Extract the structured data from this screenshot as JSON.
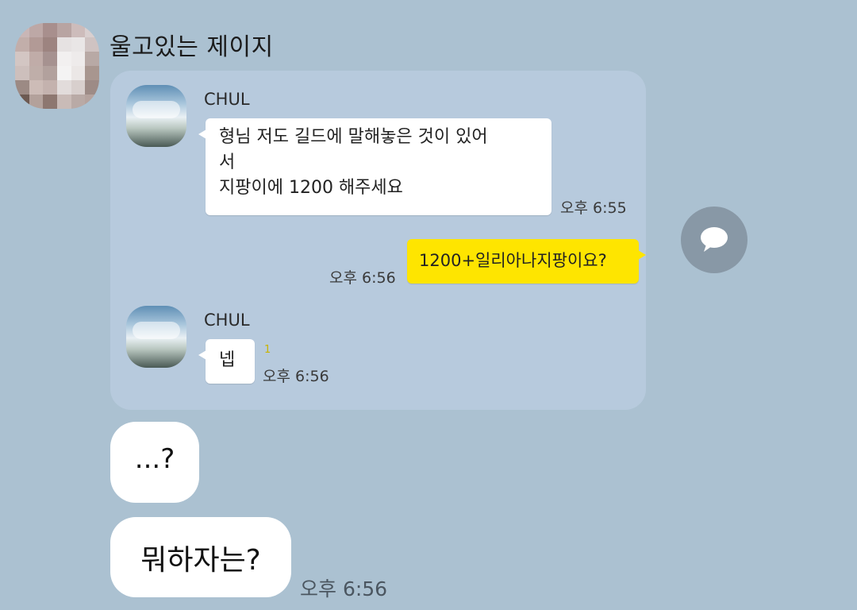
{
  "chat": {
    "sender_name": "울고있는 제이지",
    "shared_image": {
      "messages": [
        {
          "sender": "CHUL",
          "lines": [
            "형님 저도 길드에 말해놓은 것이 있어",
            "서",
            "지팡이에 1200 해주세요"
          ],
          "time": "오후 6:55"
        },
        {
          "self": true,
          "text": "1200+일리아나지팡이요?",
          "time": "오후 6:56"
        },
        {
          "sender": "CHUL",
          "text": "넵",
          "read_count": "1",
          "time": "오후 6:56"
        }
      ]
    },
    "messages": [
      {
        "text": "...?"
      },
      {
        "text": "뭐하자는?",
        "time": "오후 6:56"
      }
    ]
  },
  "icons": {
    "share": "speech-bubble-icon"
  },
  "colors": {
    "background": "#abc1d1",
    "self_bubble": "#fee500",
    "other_bubble": "#ffffff",
    "share_button": "#8898a6"
  }
}
